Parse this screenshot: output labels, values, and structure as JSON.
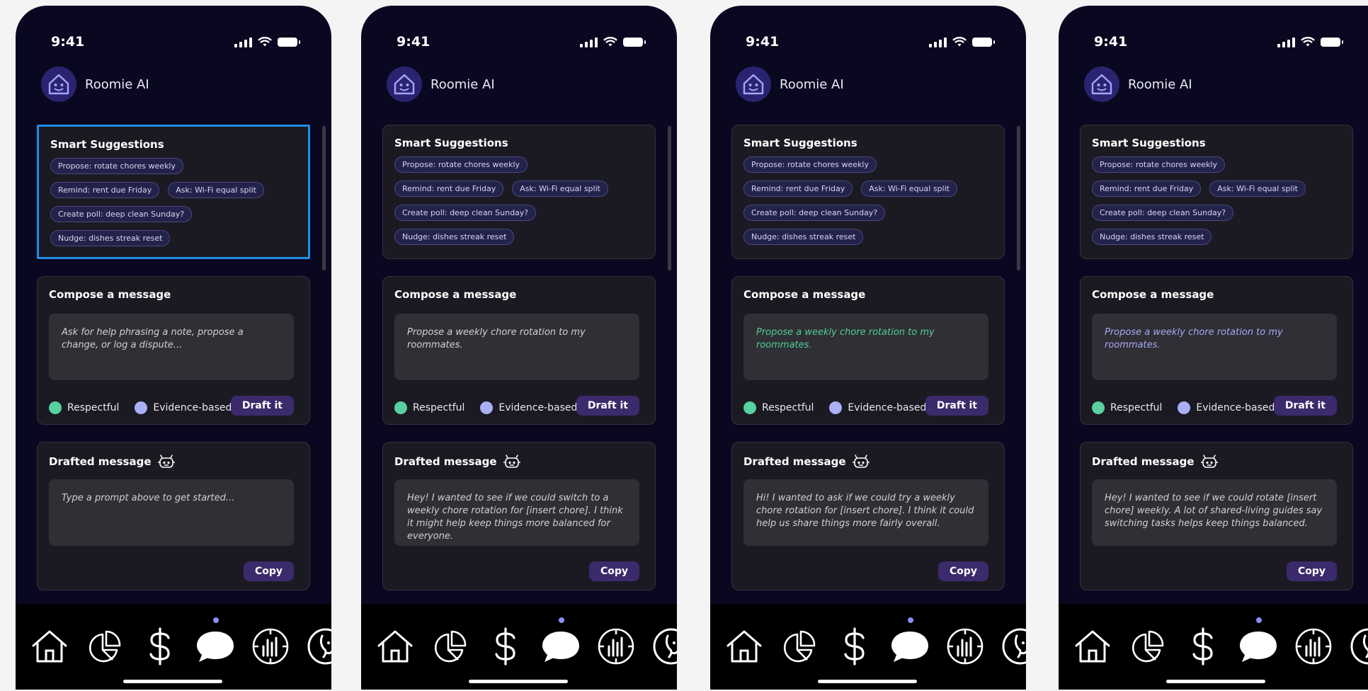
{
  "status_time": "9:41",
  "app_name": "Roomie AI",
  "suggestions_title": "Smart Suggestions",
  "chips": [
    "Propose: rotate chores weekly",
    "Remind: rent due Friday",
    "Ask: Wi-Fi equal split",
    "Create poll: deep clean Sunday?",
    "Nudge: dishes streak reset"
  ],
  "compose_title": "Compose a message",
  "compose_placeholder": "Ask for help phrasing a note, propose a change, or log a dispute...",
  "prompt_text": "Propose a weekly chore rotation to my roommates.",
  "tone_respectful": "Respectful",
  "tone_evidence": "Evidence-based",
  "draft_button": "Draft it",
  "drafted_title": "Drafted message",
  "drafted_placeholder": "Type a prompt above to get started...",
  "draft_responses": [
    "Hey! I wanted to see if we could switch to a weekly chore rotation for [insert chore]. I think it might help keep things more balanced for everyone.",
    "Hi! I wanted to ask if we could try a weekly chore rotation for [insert chore]. I think it could help us share things more fairly overall.",
    "Hey! I wanted to see if we could rotate [insert chore] weekly. A lot of shared-living guides say switching tasks helps keep things balanced."
  ],
  "copy_button": "Copy",
  "tabs": [
    "home-icon",
    "pie-chart-icon",
    "dollar-icon",
    "chat-icon",
    "stats-icon",
    "profile-icon"
  ],
  "colors": {
    "background": "#0a0820",
    "card": "#1b1a22",
    "accent": "#3b2a6c",
    "chip": "#23224a",
    "focus": "#1e8fe6",
    "green_text": "#4fcf94",
    "lavender_text": "#a8a8f5"
  }
}
